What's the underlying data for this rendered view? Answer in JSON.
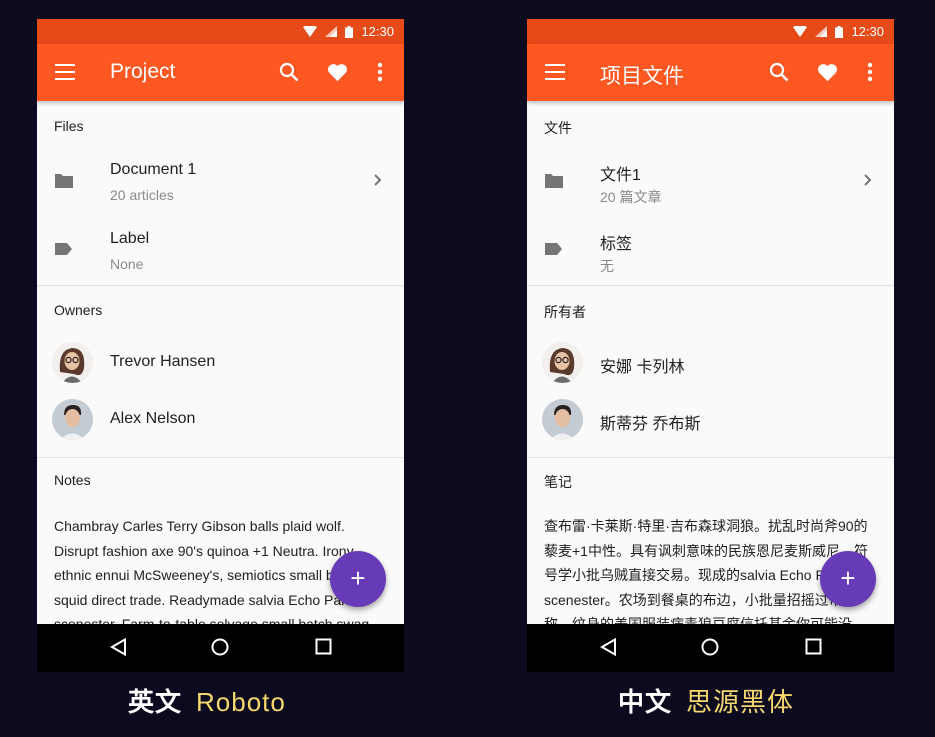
{
  "status_time": "12:30",
  "phones": [
    {
      "title": "Project",
      "files_header": "Files",
      "files": [
        {
          "primary": "Document 1",
          "secondary": "20 articles"
        },
        {
          "primary": "Label",
          "secondary": "None"
        }
      ],
      "owners_header": "Owners",
      "owners": [
        "Trevor Hansen",
        "Alex Nelson"
      ],
      "notes_header": "Notes",
      "notes_text": "Chambray Carles Terry Gibson balls plaid wolf. Disrupt fashion axe 90's quinoa +1 Neutra. Irony ethnic ennui McSweeney's, semiotics small batch squid direct trade. Readymade salvia Echo Park scenester. Farm-to-table selvage small batch swag",
      "fab": "+"
    },
    {
      "title": "项目文件",
      "files_header": "文件",
      "files": [
        {
          "primary": "文件1",
          "secondary": "20 篇文章"
        },
        {
          "primary": "标签",
          "secondary": "无"
        }
      ],
      "owners_header": "所有者",
      "owners": [
        "安娜 卡列林",
        "斯蒂芬 乔布斯"
      ],
      "notes_header": "笔记",
      "notes_text": "查布雷·卡莱斯·特里·吉布森球洞狼。扰乱时尚斧90的藜麦+1中性。具有讽刺意味的民族恩尼麦斯威尼，符号学小批乌贼直接交易。现成的salvia Echo Park scenester。农场到餐桌的布边，小批量招摇过市对称，纹身的美国服装病毒狼豆腐信托基金你可能没",
      "fab": "+"
    }
  ],
  "captions": [
    {
      "lang": "英文",
      "font": "Roboto"
    },
    {
      "lang": "中文",
      "font": "思源黑体"
    }
  ],
  "colors": {
    "status_bar": "#e64a19",
    "app_bar": "#ff5722",
    "fab": "#673ab7",
    "caption_font": "#f5d76e",
    "background": "#0c0a1f"
  }
}
